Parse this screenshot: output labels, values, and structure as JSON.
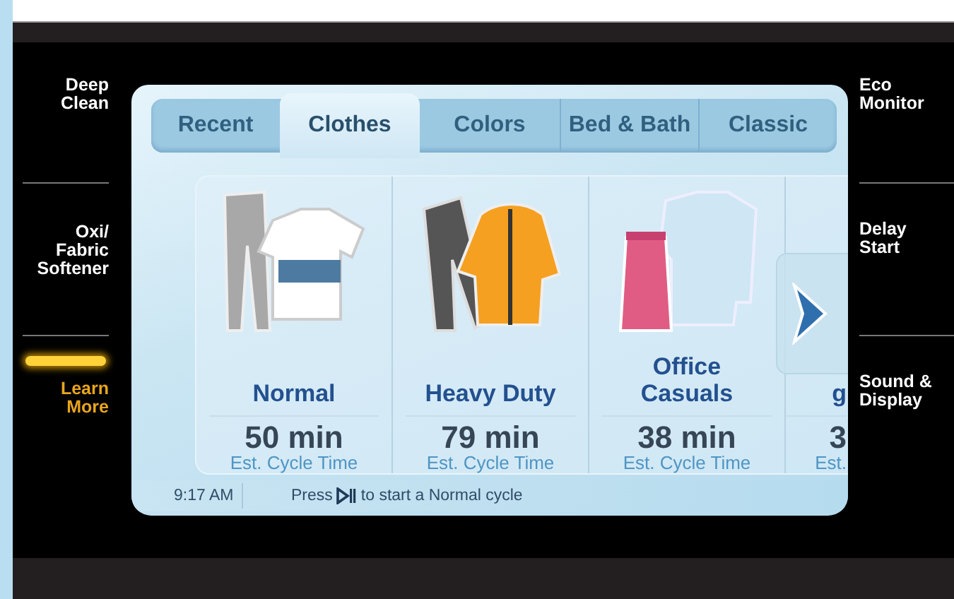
{
  "left_menu": [
    {
      "label": "Deep Clean",
      "selected": false
    },
    {
      "label": "Oxi/ Fabric Softener",
      "selected": false
    },
    {
      "label": "Learn More",
      "selected": true
    }
  ],
  "tabs": [
    {
      "label": "Recent",
      "selected": false
    },
    {
      "label": "Clothes",
      "selected": true
    },
    {
      "label": "Colors",
      "selected": false
    },
    {
      "label": "Bed & Bath",
      "selected": false
    },
    {
      "label": "Classic",
      "selected": false
    }
  ],
  "cycles": [
    {
      "kind": "full",
      "name_lines": [
        "Normal"
      ],
      "time": "50 min",
      "time_label": "Est. Cycle Time"
    },
    {
      "kind": "full",
      "name_lines": [
        "Heavy Duty"
      ],
      "time": "79 min",
      "time_label": "Est. Cycle Time"
    },
    {
      "kind": "full",
      "name_lines": [
        "Office",
        "Casuals"
      ],
      "time": "38 min",
      "time_label": "Est. Cycle Time"
    },
    {
      "kind": "cut",
      "name_lines": [
        "g"
      ],
      "time": "3",
      "time_label": "Est."
    }
  ],
  "status_bar": {
    "time": "9:17 AM",
    "hint_before": "Press",
    "hint_after": "to start a Normal cycle"
  },
  "right_menu": [
    {
      "label": "Eco Monitor",
      "selected": false
    },
    {
      "label": "Delay Start",
      "selected": false
    },
    {
      "label": "Sound & Display",
      "selected": false
    }
  ]
}
